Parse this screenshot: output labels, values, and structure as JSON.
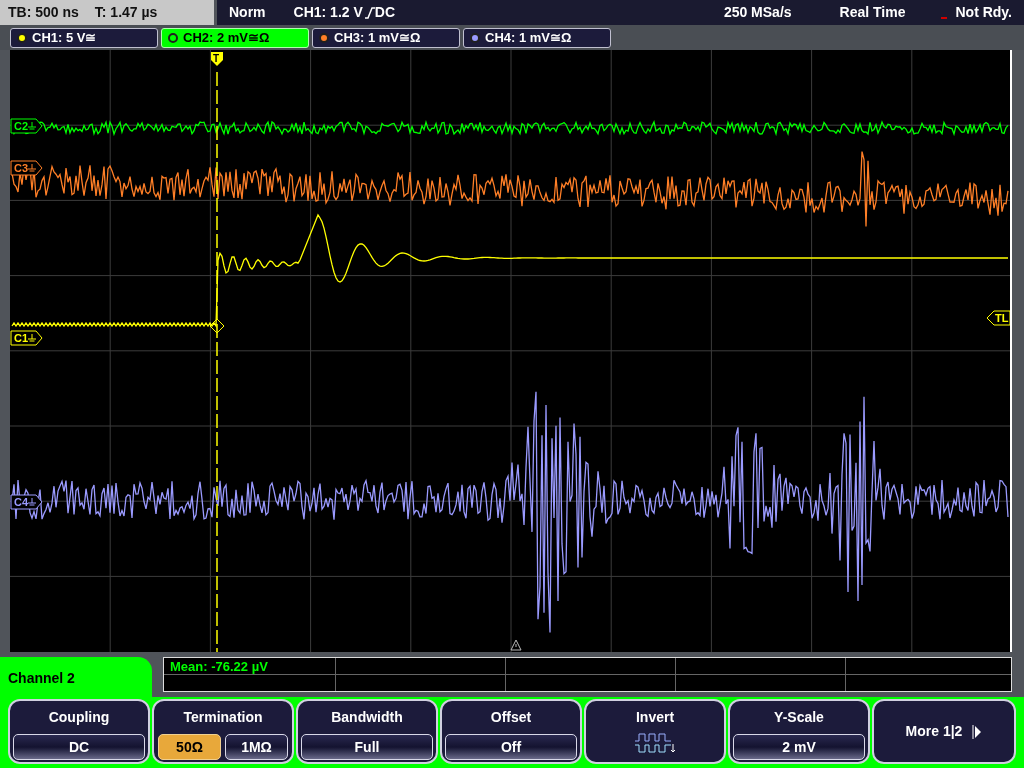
{
  "status": {
    "timebase": "TB: 500 ns",
    "trigger_time": "T: 1.47 µs",
    "mode": "Norm",
    "trigger_source": "CH1: 1.2 V",
    "trigger_coupling": "DC",
    "sample_rate": "250 MSa/s",
    "acquisition": "Real Time",
    "state": "Not Rdy."
  },
  "channels": [
    {
      "label": "CH1: 5 V≅",
      "color": "#ffff00",
      "selected": false
    },
    {
      "label": "CH2: 2 mV≅Ω",
      "color": "#00ff00",
      "selected": true
    },
    {
      "label": "CH3: 1 mV≅Ω",
      "color": "#ff7f27",
      "selected": false
    },
    {
      "label": "CH4: 1 mV≅Ω",
      "color": "#9a9aff",
      "selected": false
    }
  ],
  "display": {
    "markers": [
      {
        "text": "C2",
        "color": "#00ff00"
      },
      {
        "text": "C3",
        "color": "#ff7f27"
      },
      {
        "text": "C1",
        "color": "#ffff00"
      },
      {
        "text": "C4",
        "color": "#9a9aff"
      }
    ],
    "trigger_marker": "T",
    "trigger_level_marker": "TL"
  },
  "measurement": {
    "text": "Mean: -76.22 µV"
  },
  "menu": {
    "title": "Channel 2",
    "softkeys": [
      {
        "kind": "value",
        "label": "Coupling",
        "value": "DC"
      },
      {
        "kind": "toggle",
        "label": "Termination",
        "options": [
          {
            "text": "50Ω",
            "selected": true
          },
          {
            "text": "1MΩ",
            "selected": false
          }
        ]
      },
      {
        "kind": "value",
        "label": "Bandwidth",
        "value": "Full"
      },
      {
        "kind": "value",
        "label": "Offset",
        "value": "Off"
      },
      {
        "kind": "icon",
        "label": "Invert"
      },
      {
        "kind": "value",
        "label": "Y-Scale",
        "value": "2 mV"
      },
      {
        "kind": "more",
        "label": "More 1|2"
      }
    ]
  }
}
